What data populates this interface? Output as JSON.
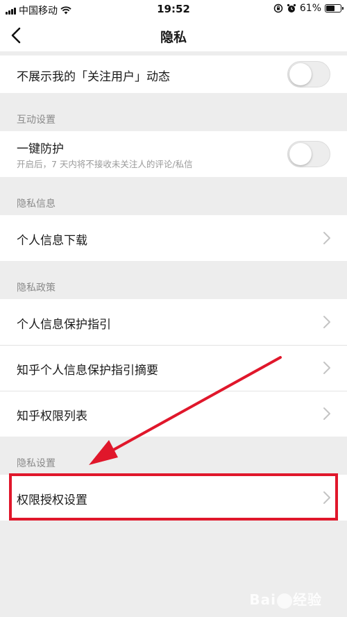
{
  "status_bar": {
    "carrier": "中国移动",
    "time": "19:52",
    "battery": "61%",
    "battery_level": 0.61
  },
  "nav": {
    "title": "隐私",
    "back_icon": "chevron-left-icon"
  },
  "rows": {
    "hide_follow": {
      "label": "不展示我的「关注用户」动态",
      "toggle_on": false
    },
    "one_key_protect": {
      "label": "一键防护",
      "sub": "开启后，7 天内将不接收未关注人的评论/私信",
      "toggle_on": false
    },
    "personal_info_download": {
      "label": "个人信息下载"
    },
    "protection_guide": {
      "label": "个人信息保护指引"
    },
    "guide_summary": {
      "label": "知乎个人信息保护指引摘要"
    },
    "permission_list": {
      "label": "知乎权限列表"
    },
    "permission_settings": {
      "label": "权限授权设置"
    }
  },
  "sections": {
    "interaction": "互动设置",
    "privacy_info": "隐私信息",
    "privacy_policy": "隐私政策",
    "privacy_settings": "隐私设置"
  },
  "annotation": {
    "color": "#e0172b"
  },
  "watermark": {
    "text_left": "Bai",
    "text_right": "经验"
  }
}
